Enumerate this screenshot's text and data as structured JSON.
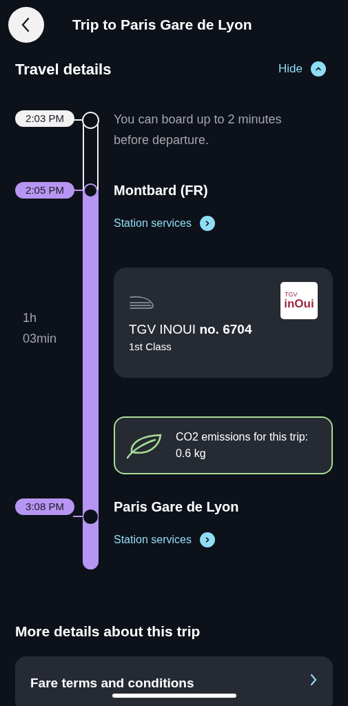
{
  "header": {
    "title": "Trip to Paris Gare de Lyon"
  },
  "travel_details": {
    "title": "Travel details",
    "toggle": "Hide",
    "expanded": true
  },
  "boarding": {
    "time": "2:03 PM",
    "note": "You can board up to 2 minutes before departure."
  },
  "departure": {
    "time": "2:05 PM",
    "station": "Montbard (FR)",
    "services": "Station services"
  },
  "duration": "1h 03min",
  "train": {
    "name": "TGV INOUI **no. 6704**",
    "class": "1st Class",
    "logo_small": "TGV",
    "logo_main": "inOui"
  },
  "co2": {
    "label": "CO2 emissions for this trip:",
    "value": "0.6 kg"
  },
  "arrival": {
    "time": "3:08 PM",
    "station": "Paris Gare de Lyon",
    "services": "Station services"
  },
  "more": {
    "title": "More details about this trip",
    "items": [
      {
        "label": "Fare terms and conditions"
      }
    ]
  }
}
